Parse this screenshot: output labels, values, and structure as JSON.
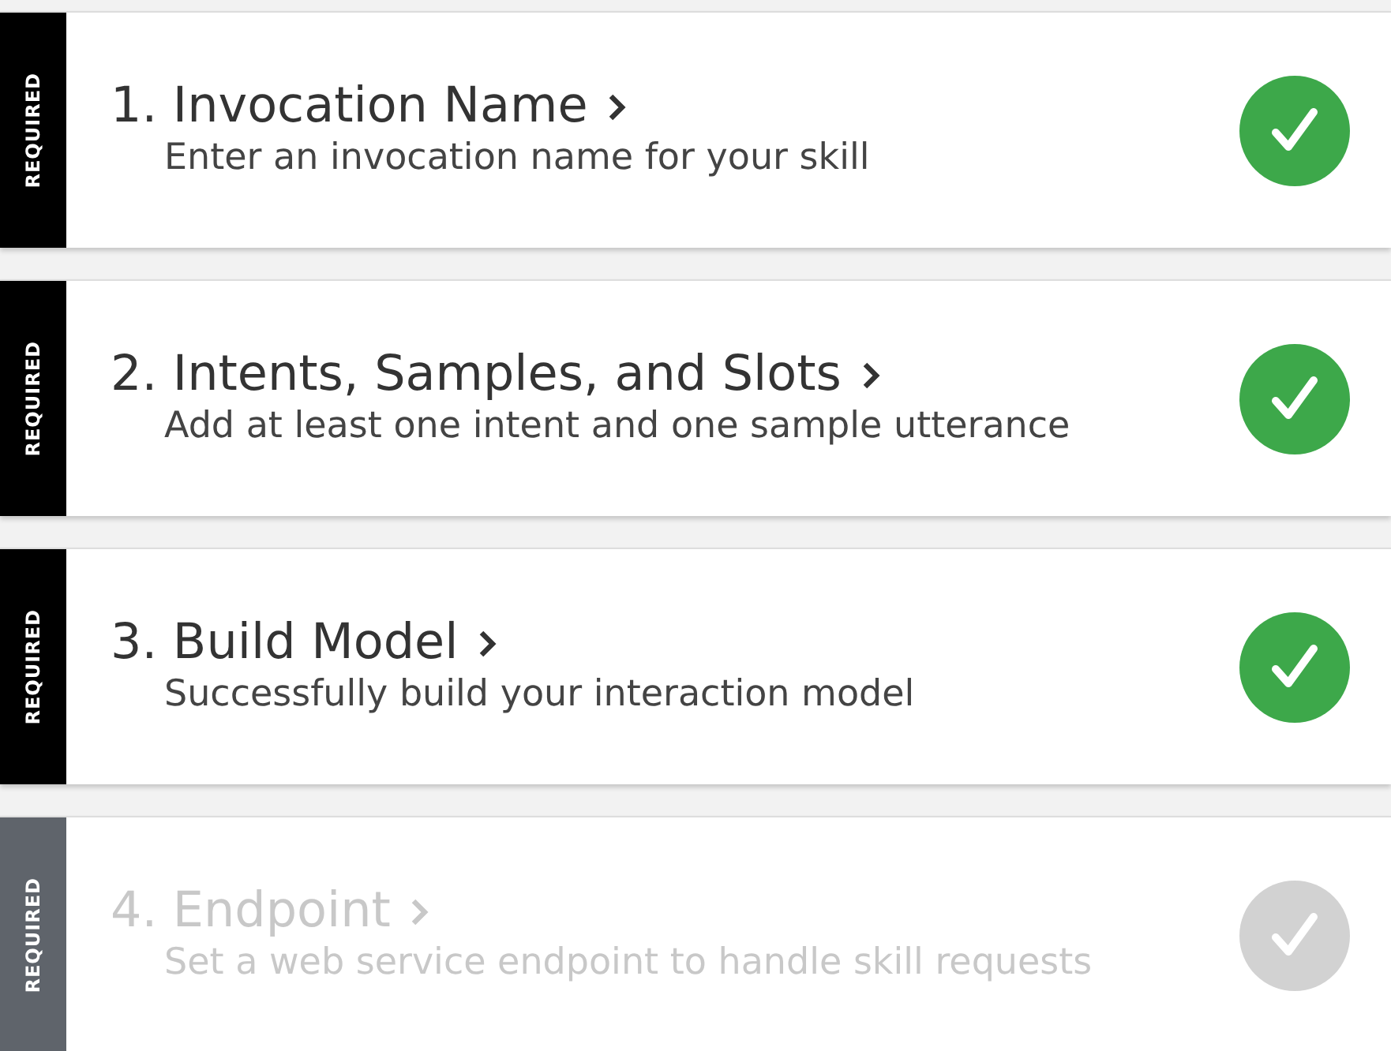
{
  "steps": [
    {
      "badge": "REQUIRED",
      "title": "1. Invocation Name",
      "description": "Enter an invocation name for your skill",
      "checked": true,
      "disabled": false
    },
    {
      "badge": "REQUIRED",
      "title": "2. Intents, Samples, and Slots",
      "description": "Add at least one intent and one sample utterance",
      "checked": true,
      "disabled": false
    },
    {
      "badge": "REQUIRED",
      "title": "3. Build Model",
      "description": "Successfully build your interaction model",
      "checked": true,
      "disabled": false
    },
    {
      "badge": "REQUIRED",
      "title": "4. Endpoint",
      "description": "Set a web service endpoint to handle skill requests",
      "checked": false,
      "disabled": true
    }
  ]
}
